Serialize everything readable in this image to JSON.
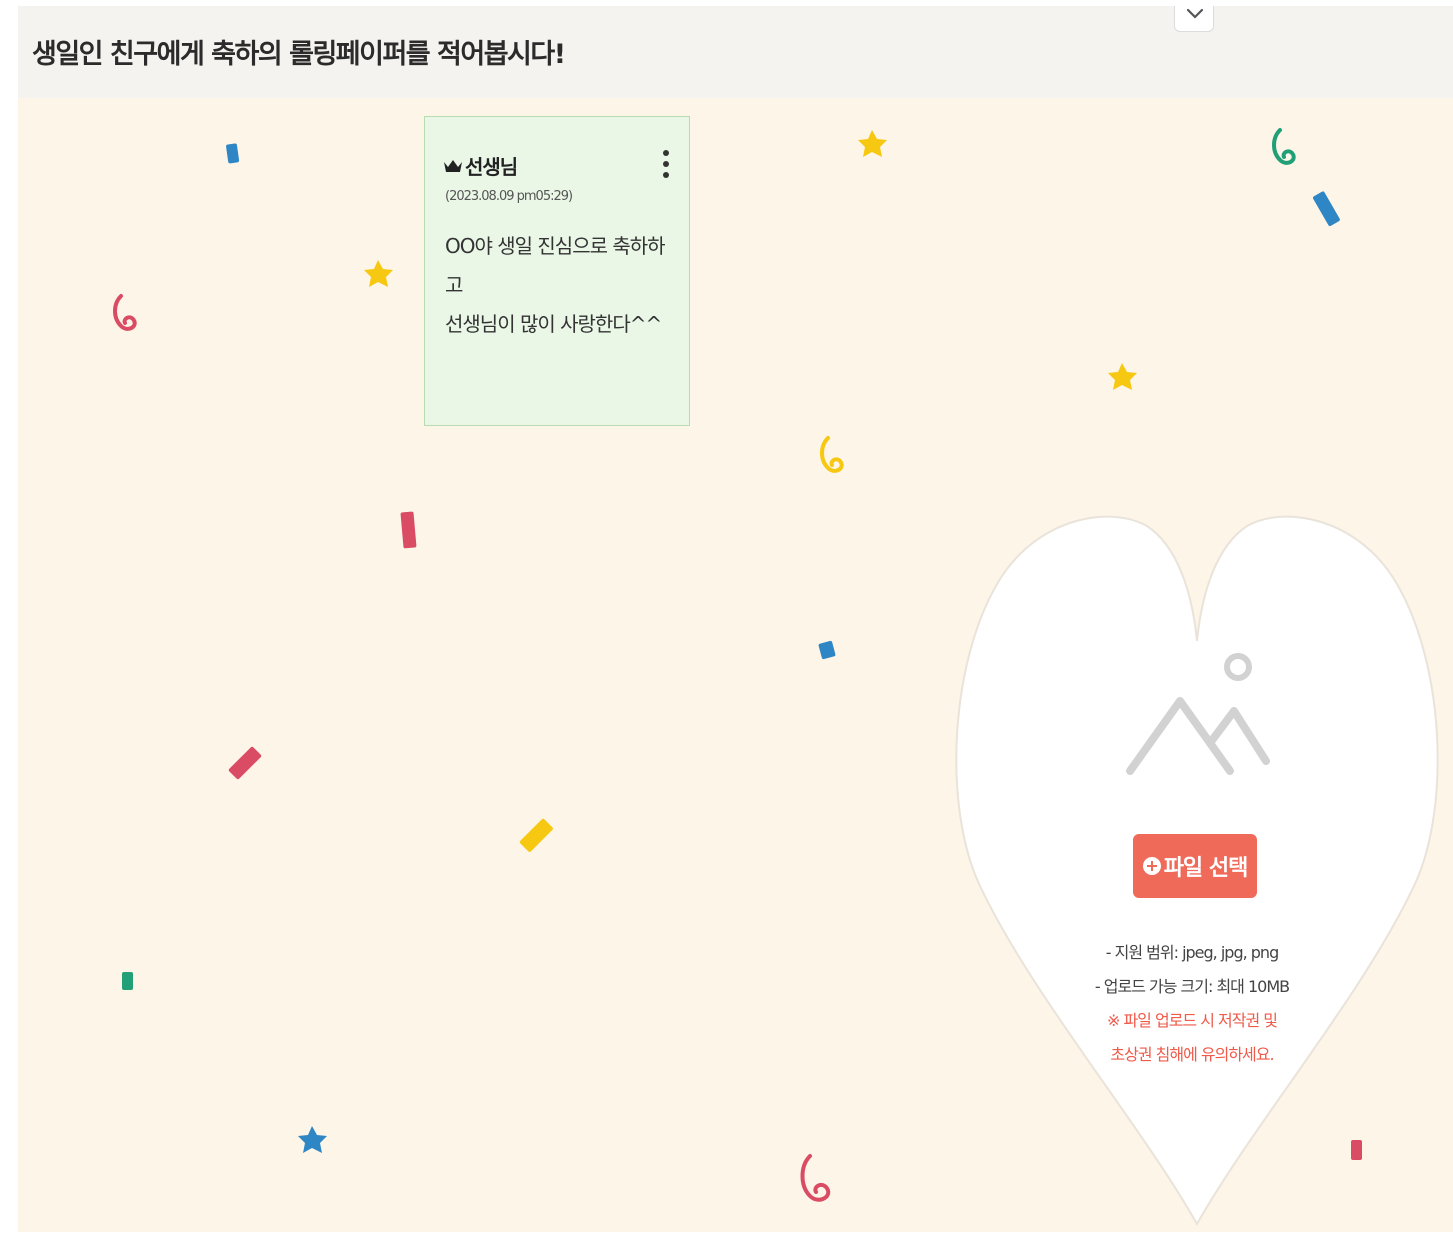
{
  "header": {
    "title": "생일인 친구에게 축하의 롤링페이퍼를 적어봅시다!"
  },
  "note": {
    "author": "선생님",
    "date": "(2023.08.09 pm05:29)",
    "message_lines": [
      "OO야 생일 진심으로 축하하고",
      "선생님이 많이 사랑한다^^"
    ],
    "background": "#eaf7e7"
  },
  "upload": {
    "button_label": "파일 선택",
    "supported": "- 지원 범위: jpeg, jpg, png",
    "max_size": "- 업로드 가능 크기: 최대 10MB",
    "warning_line1": "※ 파일 업로드 시 저작권 및",
    "warning_line2": "초상권 침해에 유의하세요.",
    "button_color": "#f06a5a"
  },
  "icons": [
    "chevron-down-icon",
    "crown-icon",
    "kebab-menu-icon",
    "image-placeholder-icon",
    "plus-circle-icon"
  ],
  "colors": {
    "board_background": "#fdf5e8",
    "header_background": "#f4f3ef",
    "confetti": [
      "#2f86c4",
      "#f6c811",
      "#d94c64",
      "#21a078"
    ]
  }
}
